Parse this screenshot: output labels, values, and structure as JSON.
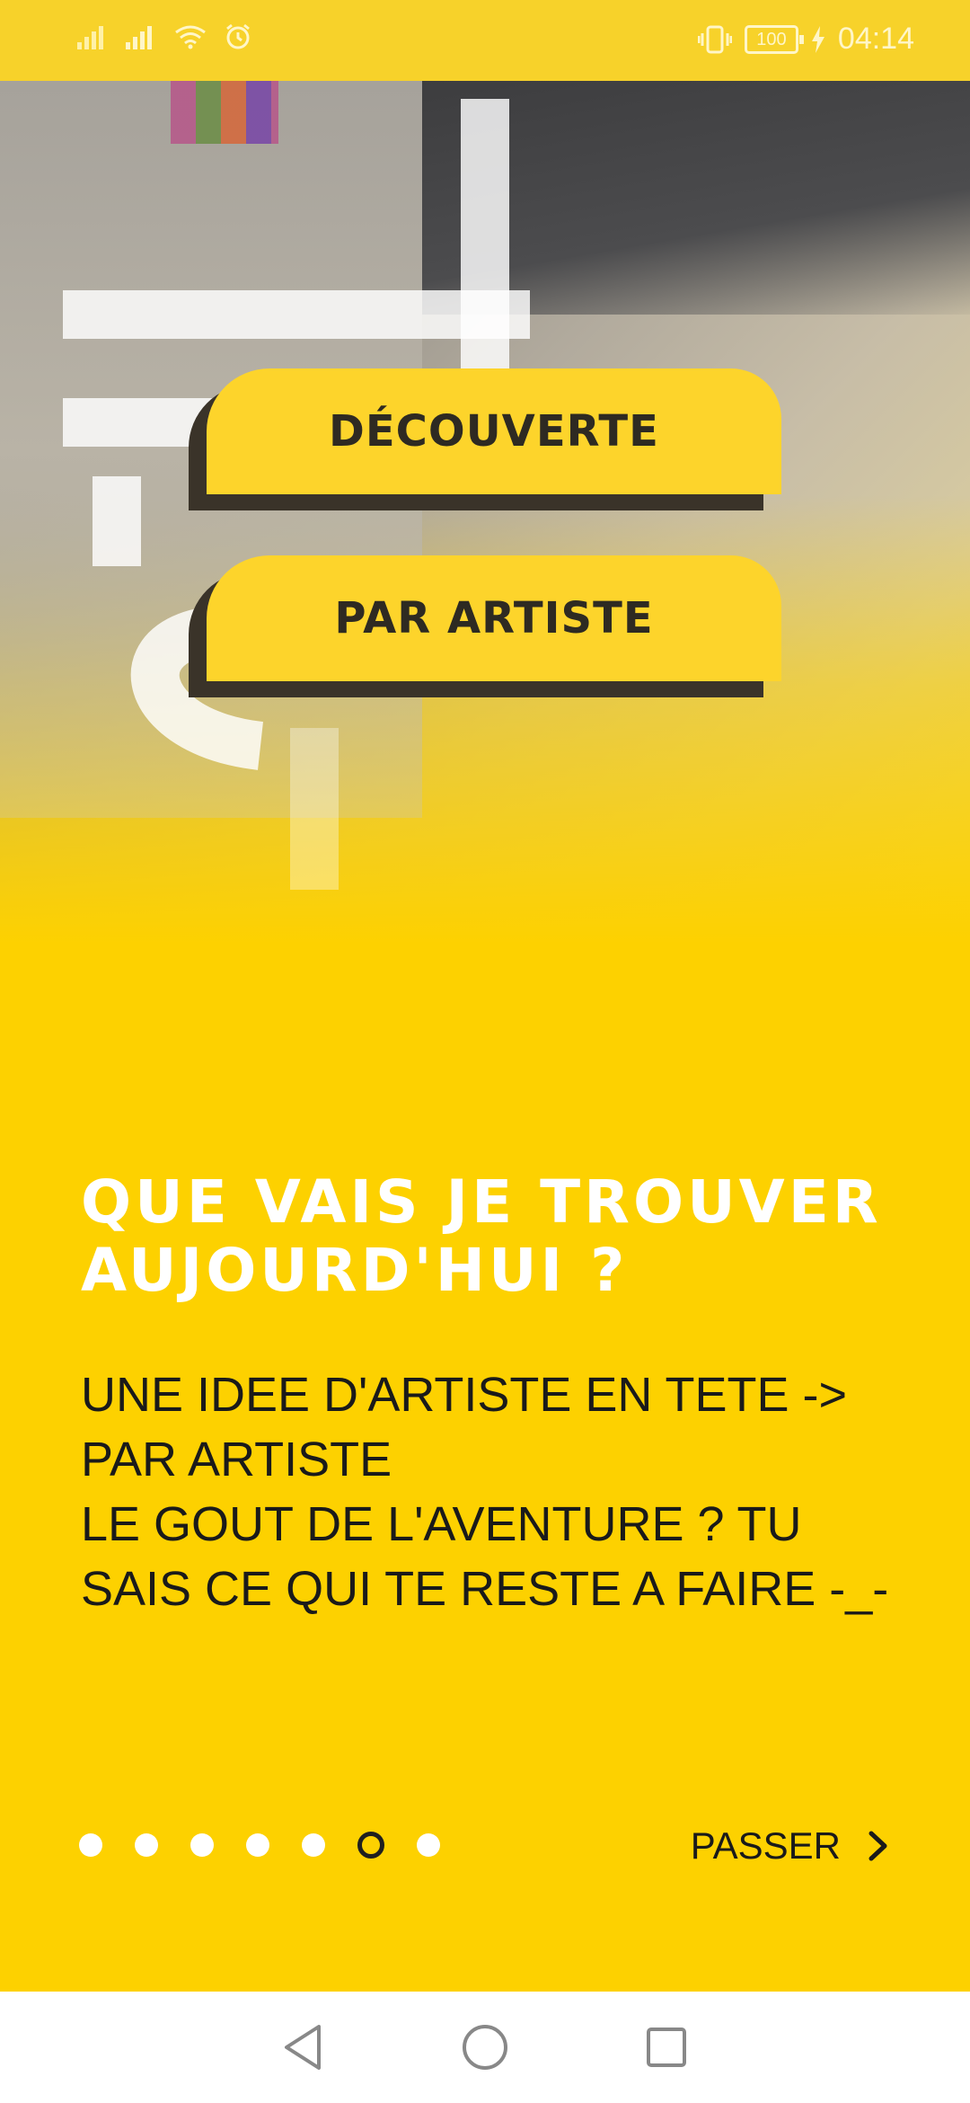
{
  "status_bar": {
    "time": "04:14",
    "battery": "100",
    "icons": [
      "signal-icon",
      "signal-icon",
      "wifi-icon",
      "alarm-icon",
      "vibrate-icon",
      "battery-icon",
      "charging-icon"
    ]
  },
  "menu": {
    "decouverte_label": "DÉCOUVERTE",
    "artiste_label": "PAR ARTISTE"
  },
  "onboarding": {
    "title": "QUE VAIS JE TROUVER AUJOURD'HUI ?",
    "body": "UNE IDEE D'ARTISTE EN TETE -> PAR ARTISTE\n LE GOUT DE L'AVENTURE ? TU SAIS CE QUI TE RESTE A FAIRE -_-",
    "page_count": 7,
    "active_page": 6,
    "skip_label": "PASSER"
  },
  "nav": {
    "icons": [
      "back-icon",
      "home-icon",
      "recents-icon"
    ]
  },
  "colors": {
    "background": "#FDD100",
    "button": "#FDD42B",
    "button_shadow": "#3a3329",
    "title_text": "#FFFFFF",
    "body_text": "#1a1a1a"
  }
}
